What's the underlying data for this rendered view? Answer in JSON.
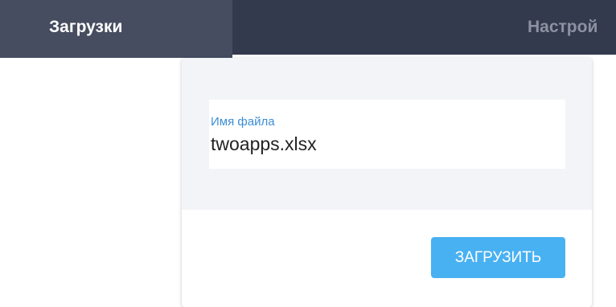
{
  "tabs": [
    {
      "label": "Загрузки",
      "active": true
    },
    {
      "label": "Настрой",
      "active": false
    }
  ],
  "upload_form": {
    "field_label": "Имя файла",
    "file_name": "twoapps.xlsx",
    "submit_label": "ЗАГРУЗИТЬ"
  },
  "colors": {
    "topbar": "#333a4d",
    "active_tab": "#464d61",
    "field_label": "#3d8ed6",
    "button": "#48b1f2",
    "card_top": "#f3f4f7"
  }
}
